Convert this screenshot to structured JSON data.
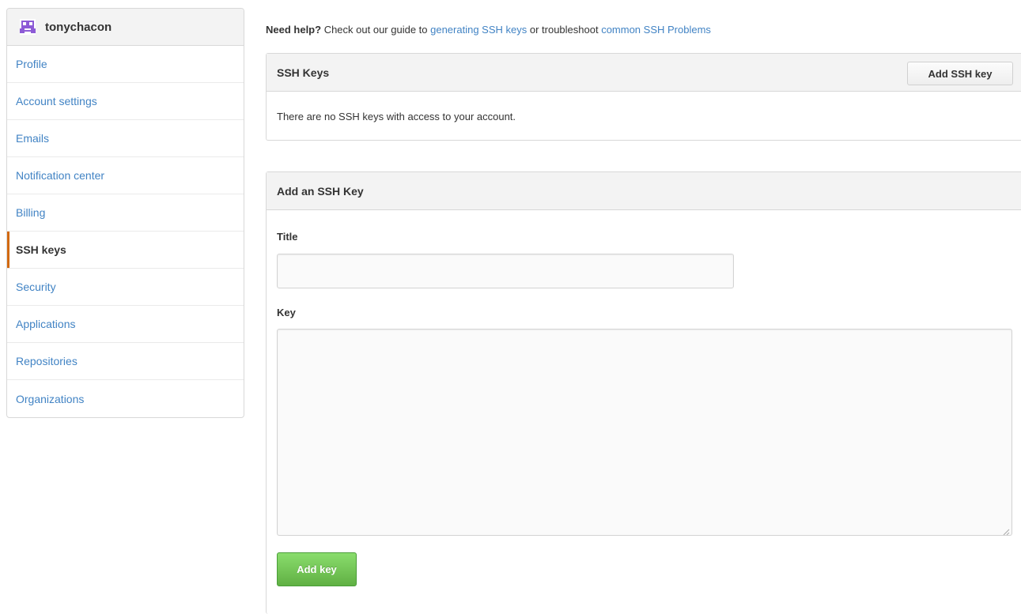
{
  "sidebar": {
    "username": "tonychacon",
    "items": [
      {
        "label": "Profile"
      },
      {
        "label": "Account settings"
      },
      {
        "label": "Emails"
      },
      {
        "label": "Notification center"
      },
      {
        "label": "Billing"
      },
      {
        "label": "SSH keys",
        "selected": true
      },
      {
        "label": "Security"
      },
      {
        "label": "Applications"
      },
      {
        "label": "Repositories"
      },
      {
        "label": "Organizations"
      }
    ],
    "selected_accent_color": "#d26911",
    "link_color": "#4183c4"
  },
  "help": {
    "strong": "Need help?",
    "text1": " Check out our guide to ",
    "link1": "generating SSH keys",
    "text2": " or troubleshoot ",
    "link2": "common SSH Problems"
  },
  "ssh_keys_box": {
    "title": "SSH Keys",
    "add_button": "Add SSH key",
    "empty_message": "There are no SSH keys with access to your account."
  },
  "add_key_box": {
    "title": "Add an SSH Key",
    "title_label": "Title",
    "title_value": "",
    "key_label": "Key",
    "key_value": "",
    "submit_button": "Add key",
    "submit_color": "#6cc644"
  }
}
